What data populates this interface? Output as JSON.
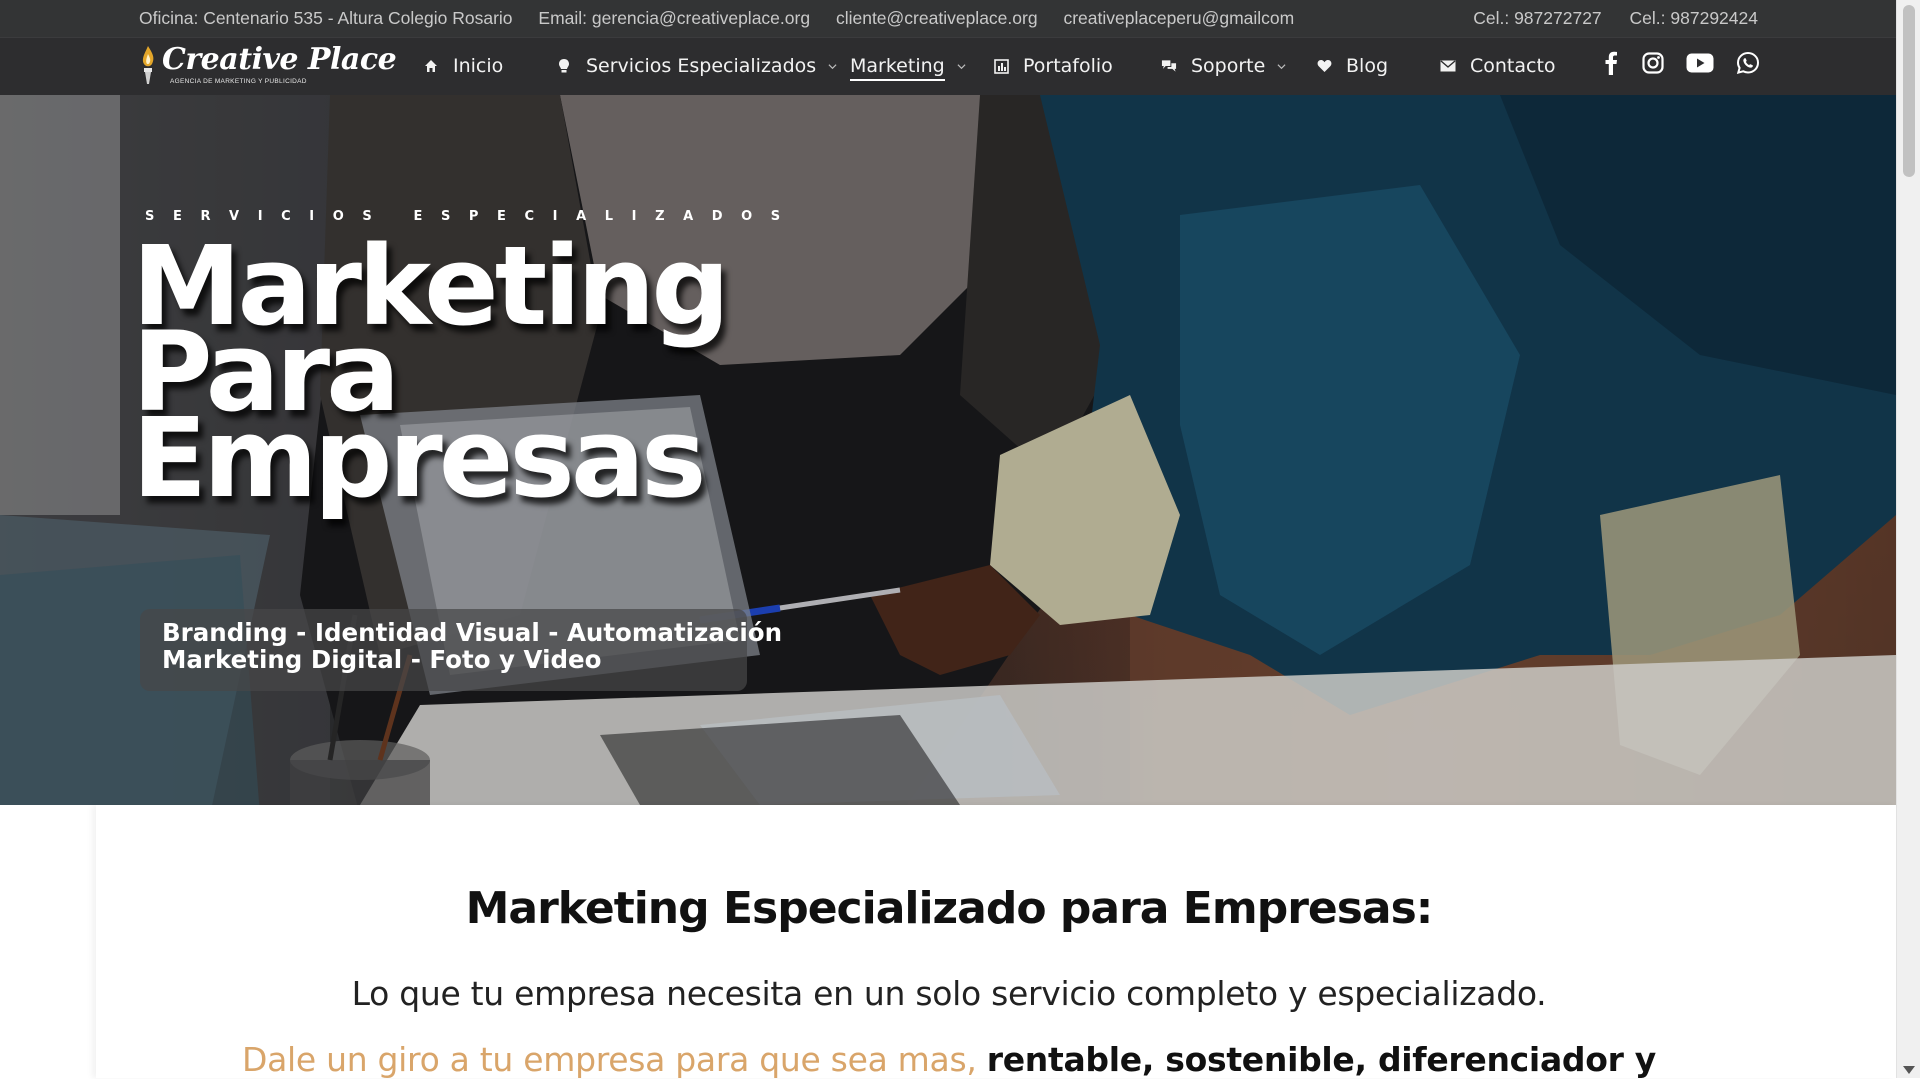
{
  "topbar": {
    "office": "Oficina: Centenario 535 - Altura Colegio Rosario",
    "email_gerencia": "Email: gerencia@creativeplace.org",
    "email_cliente": "cliente@creativeplace.org",
    "email_gmail": "creativeplaceperu@gmailcom",
    "phone_1": "Cel.: 987272727",
    "phone_2": "Cel.: 987292424"
  },
  "logo": {
    "name": "Creative Place",
    "tagline": "AGENCIA DE MARKETING Y PUBLICIDAD"
  },
  "nav": {
    "items": [
      {
        "label": "Inicio",
        "icon": "home-icon"
      },
      {
        "label": "Servicios Especializados",
        "icon": "lightbulb-icon",
        "dropdown": true
      },
      {
        "label": "Marketing",
        "active": true,
        "dropdown": true
      },
      {
        "label": "Portafolio",
        "icon": "chart-icon"
      },
      {
        "label": "Soporte",
        "icon": "chat-icon",
        "dropdown": true
      },
      {
        "label": "Blog",
        "icon": "heart-icon"
      },
      {
        "label": "Contacto",
        "icon": "mail-icon"
      }
    ],
    "social": [
      "facebook-icon",
      "instagram-icon",
      "youtube-icon",
      "whatsapp-icon"
    ]
  },
  "hero": {
    "kicker": "SERVICIOS ESPECIALIZADOS",
    "title_lines": [
      "Marketing",
      "Para",
      "Empresas"
    ],
    "tags_line1": "Branding - Identidad Visual - Automatización",
    "tags_line2": "Marketing Digital - Foto y Video"
  },
  "section": {
    "title": "Marketing Especializado para Empresas:",
    "subtitle": "Lo que tu empresa necesita en un solo servicio completo y especializado.",
    "line_accent": "Dale un giro a tu empresa para que sea mas, ",
    "line_rentable": "rentable",
    "line_sep1": ", ",
    "line_sostenible": "sostenible",
    "line_sep2": ", ",
    "line_diferenciador": "diferenciador y"
  },
  "colors": {
    "topbar_bg": "#333435",
    "navbar_bg": "#2d2d2f",
    "accent": "#d9a56a",
    "logo_flame": "#e3a62a"
  }
}
